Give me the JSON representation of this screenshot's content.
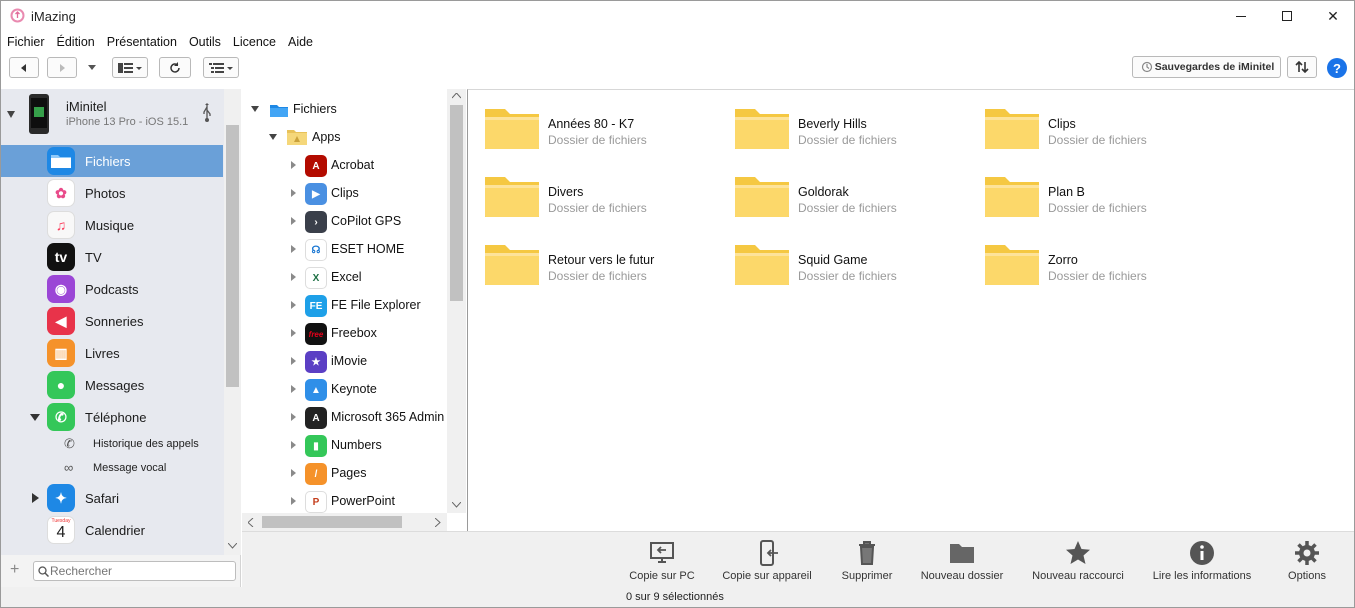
{
  "window": {
    "title": "iMazing",
    "minimize": "—",
    "maximize": "☐",
    "close": "✕"
  },
  "menu": [
    "Fichier",
    "Édition",
    "Présentation",
    "Outils",
    "Licence",
    "Aide"
  ],
  "toolbar": {
    "backup_label": "Sauvegardes de iMinitel",
    "help": "?"
  },
  "device": {
    "name": "iMinitel",
    "model": "iPhone 13 Pro - iOS 15.1"
  },
  "sidebar": {
    "items": [
      {
        "label": "Fichiers",
        "icon": "files-icon",
        "color": "#1e88e5",
        "selected": true
      },
      {
        "label": "Photos",
        "icon": "photos-icon",
        "color": "#ffffff"
      },
      {
        "label": "Musique",
        "icon": "music-icon",
        "color": "#f8f8f8"
      },
      {
        "label": "TV",
        "icon": "tv-icon",
        "color": "#111111"
      },
      {
        "label": "Podcasts",
        "icon": "podcasts-icon",
        "color": "#9b46d6"
      },
      {
        "label": "Sonneries",
        "icon": "ringtones-icon",
        "color": "#e8334a"
      },
      {
        "label": "Livres",
        "icon": "books-icon",
        "color": "#f5922a"
      },
      {
        "label": "Messages",
        "icon": "messages-icon",
        "color": "#34c759"
      },
      {
        "label": "Téléphone",
        "icon": "phone-icon",
        "color": "#34c759"
      }
    ],
    "subitems": [
      {
        "label": "Historique des appels",
        "icon": "call-history-icon"
      },
      {
        "label": "Message vocal",
        "icon": "voicemail-icon"
      }
    ],
    "items2": [
      {
        "label": "Safari",
        "icon": "safari-icon",
        "color": "#1e88e5"
      },
      {
        "label": "Calendrier",
        "icon": "calendar-icon",
        "color": "#ffffff",
        "top_text": "Tuesday",
        "day": "4"
      }
    ],
    "search_placeholder": "Rechercher"
  },
  "tree": {
    "root": "Fichiers",
    "apps": "Apps",
    "items": [
      {
        "label": "Acrobat",
        "icon": "acrobat-icon",
        "color": "#b30b00",
        "glyph": "A"
      },
      {
        "label": "Clips",
        "icon": "clips-icon",
        "color": "#4a90e2",
        "glyph": "▶"
      },
      {
        "label": "CoPilot GPS",
        "icon": "copilot-icon",
        "color": "#3a3f4a",
        "glyph": "›"
      },
      {
        "label": "ESET HOME",
        "icon": "eset-icon",
        "color": "#ffffff",
        "glyph": "☊"
      },
      {
        "label": "Excel",
        "icon": "excel-icon",
        "color": "#ffffff",
        "glyph": "X"
      },
      {
        "label": "FE File Explorer",
        "icon": "fe-icon",
        "color": "#1ea0e8",
        "glyph": "FE"
      },
      {
        "label": "Freebox",
        "icon": "freebox-icon",
        "color": "#111111",
        "glyph": "free"
      },
      {
        "label": "iMovie",
        "icon": "imovie-icon",
        "color": "#5b3fc4",
        "glyph": "★"
      },
      {
        "label": "Keynote",
        "icon": "keynote-icon",
        "color": "#2f8fe8",
        "glyph": "▲"
      },
      {
        "label": "Microsoft 365 Admin",
        "icon": "m365-admin-icon",
        "color": "#222222",
        "glyph": "A"
      },
      {
        "label": "Numbers",
        "icon": "numbers-icon",
        "color": "#34c759",
        "glyph": "▮"
      },
      {
        "label": "Pages",
        "icon": "pages-icon",
        "color": "#f5922a",
        "glyph": "/"
      },
      {
        "label": "PowerPoint",
        "icon": "powerpoint-icon",
        "color": "#ffffff",
        "glyph": "P"
      }
    ]
  },
  "folders": [
    {
      "name": "Années 80 - K7",
      "sub": "Dossier de fichiers"
    },
    {
      "name": "Beverly Hills",
      "sub": "Dossier de fichiers"
    },
    {
      "name": "Clips",
      "sub": "Dossier de fichiers"
    },
    {
      "name": "Divers",
      "sub": "Dossier de fichiers"
    },
    {
      "name": "Goldorak",
      "sub": "Dossier de fichiers"
    },
    {
      "name": "Plan B",
      "sub": "Dossier de fichiers"
    },
    {
      "name": "Retour vers le futur",
      "sub": "Dossier de fichiers"
    },
    {
      "name": "Squid Game",
      "sub": "Dossier de fichiers"
    },
    {
      "name": "Zorro",
      "sub": "Dossier de fichiers"
    }
  ],
  "actions": [
    {
      "label": "Copie sur PC",
      "icon": "copy-to-pc-icon"
    },
    {
      "label": "Copie sur appareil",
      "icon": "copy-to-device-icon"
    },
    {
      "label": "Supprimer",
      "icon": "trash-icon"
    },
    {
      "label": "Nouveau dossier",
      "icon": "new-folder-icon"
    },
    {
      "label": "Nouveau raccourci",
      "icon": "star-icon"
    },
    {
      "label": "Lire les informations",
      "icon": "info-icon"
    },
    {
      "label": "Options",
      "icon": "gear-icon"
    }
  ],
  "status": "0 sur 9 sélectionnés"
}
